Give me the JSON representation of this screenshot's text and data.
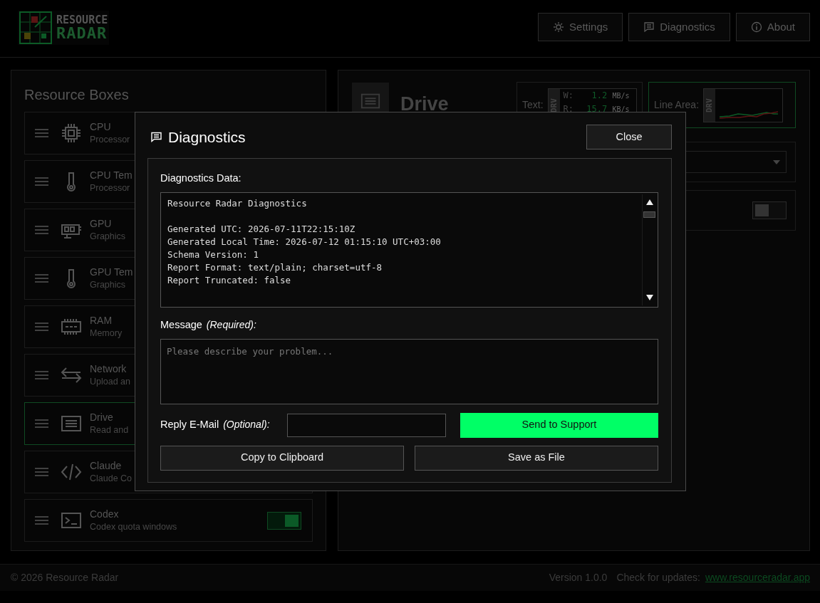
{
  "header": {
    "logo": {
      "line_1": "RESOURCE",
      "line_2": "RADAR"
    },
    "buttons": [
      {
        "label": "Settings"
      },
      {
        "label": "Diagnostics"
      },
      {
        "label": "About"
      }
    ]
  },
  "resource_boxes": {
    "title": "Resource Boxes",
    "items": [
      {
        "title": "CPU",
        "subtitle": "Processor",
        "selected": false
      },
      {
        "title": "CPU Tem",
        "subtitle": "Processor",
        "selected": false
      },
      {
        "title": "GPU",
        "subtitle": "Graphics",
        "selected": false
      },
      {
        "title": "GPU Tem",
        "subtitle": "Graphics",
        "selected": false
      },
      {
        "title": "RAM",
        "subtitle": "Memory",
        "selected": false
      },
      {
        "title": "Network",
        "subtitle": "Upload an",
        "selected": false
      },
      {
        "title": "Drive",
        "subtitle": "Read and",
        "selected": true
      },
      {
        "title": "Claude",
        "subtitle": "Claude Co",
        "selected": false
      },
      {
        "title": "Codex",
        "subtitle": "Codex quota windows",
        "selected": false,
        "on": true
      }
    ]
  },
  "detail": {
    "title": "Drive",
    "text_preview": {
      "label": "Text:",
      "tag": "DRV",
      "rows": [
        {
          "name": "W:",
          "value": "1.2",
          "unit": "MB/s"
        },
        {
          "name": "R:",
          "value": "15.7",
          "unit": "KB/s"
        }
      ],
      "selected": false
    },
    "line_area_preview": {
      "label": "Line Area:",
      "tag": "DRV",
      "selected": true
    },
    "toggle": {
      "on": false
    }
  },
  "dialog": {
    "title": "Diagnostics",
    "close": "Close",
    "data_label": "Diagnostics Data:",
    "data_heading": "Resource Radar Diagnostics",
    "data_lines": [
      "Generated UTC: 2026-07-11T22:15:10Z",
      "Generated Local Time: 2026-07-12 01:15:10 UTC+03:00",
      "Schema Version: 1",
      "Report Format: text/plain; charset=utf-8",
      "Report Truncated: false"
    ],
    "message_label": "Message",
    "message_note": "(Required):",
    "message": {
      "placeholder": "Please describe your problem..."
    },
    "email_label": "Reply E-Mail",
    "email_note": "(Optional):",
    "send": "Send to Support",
    "copy": "Copy to Clipboard",
    "save": "Save as File"
  },
  "footer": {
    "copyright": "© 2026 Resource Radar",
    "version": "Version 1.0.0",
    "updates_label": "Check for updates:",
    "link": "www.resourceradar.app"
  }
}
